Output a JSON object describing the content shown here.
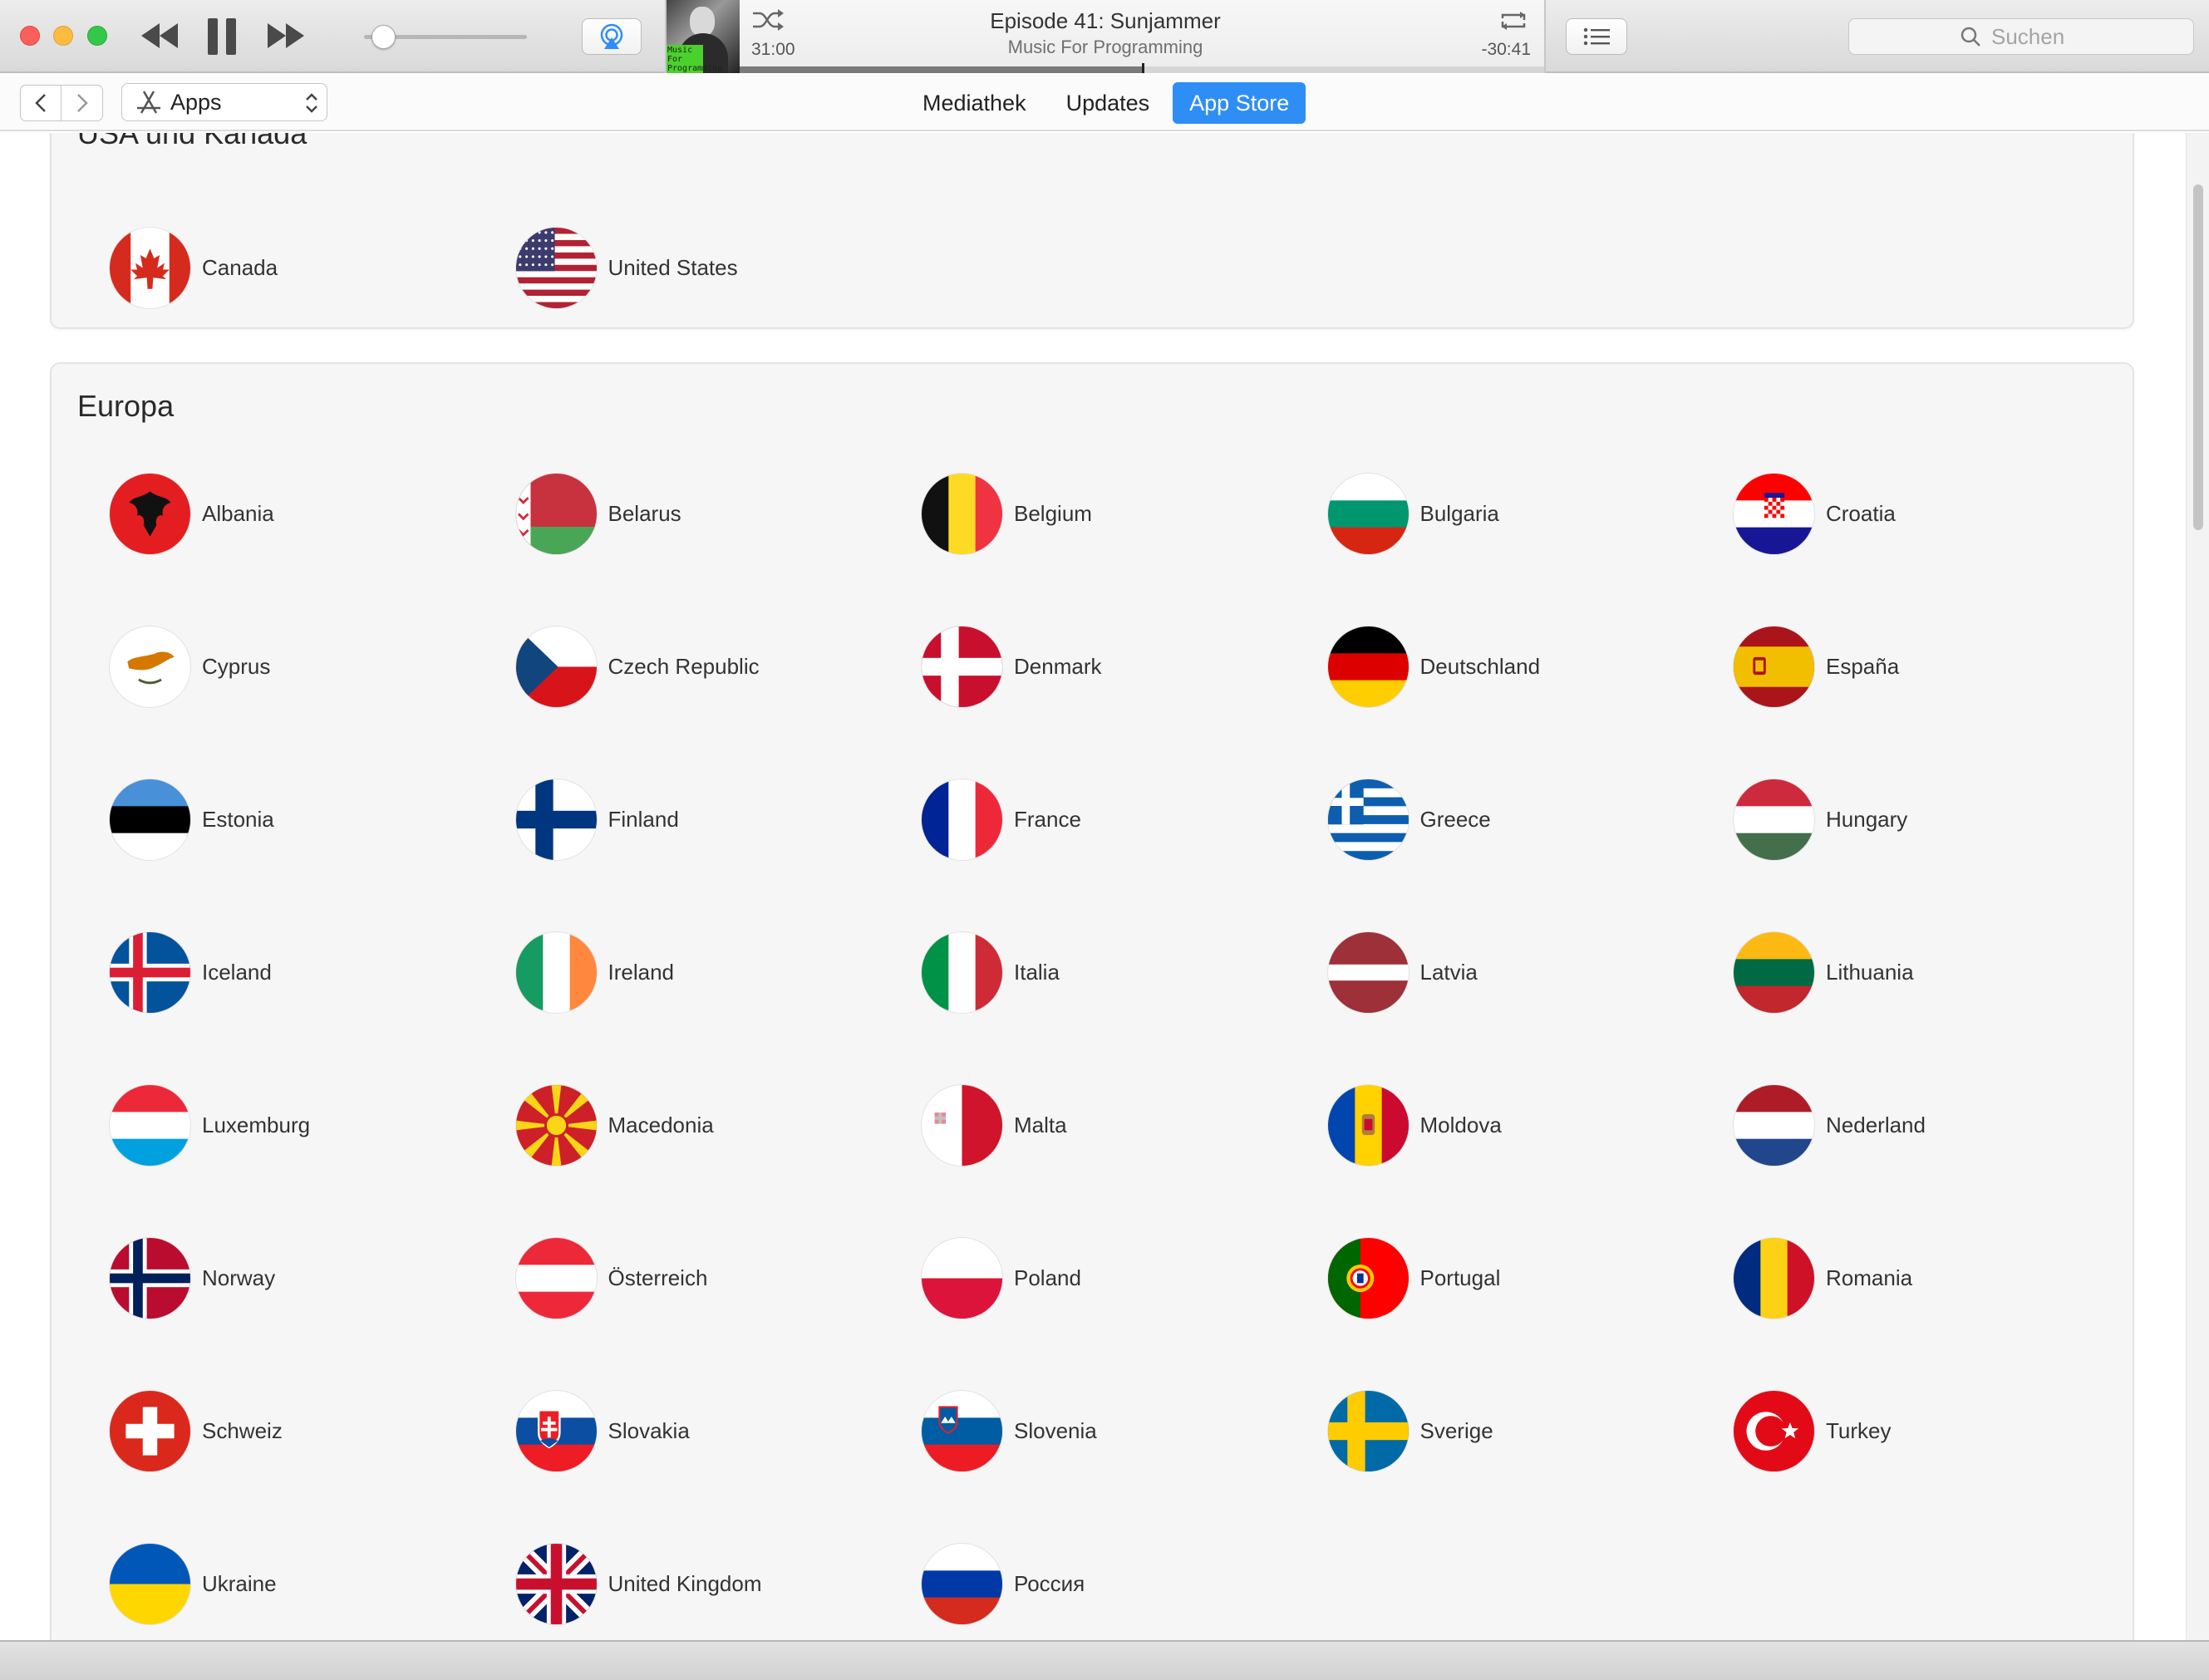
{
  "player": {
    "title": "Episode 41: Sunjammer",
    "artist": "Music For Programming",
    "elapsed": "31:00",
    "remaining": "-30:41",
    "progress": 0.5,
    "volume": 0.05,
    "artwork_label": "Music For Programming"
  },
  "search": {
    "placeholder": "Suchen"
  },
  "nav": {
    "media_kind": "Apps",
    "tabs": [
      {
        "label": "Mediathek",
        "active": false
      },
      {
        "label": "Updates",
        "active": false
      },
      {
        "label": "App Store",
        "active": true
      }
    ]
  },
  "sections": [
    {
      "title": "USA und Kanada",
      "countries": [
        {
          "name": "Canada",
          "flag": "ca"
        },
        {
          "name": "United States",
          "flag": "us"
        }
      ]
    },
    {
      "title": "Europa",
      "countries": [
        {
          "name": "Albania",
          "flag": "al"
        },
        {
          "name": "Belarus",
          "flag": "by"
        },
        {
          "name": "Belgium",
          "flag": "be"
        },
        {
          "name": "Bulgaria",
          "flag": "bg"
        },
        {
          "name": "Croatia",
          "flag": "hr"
        },
        {
          "name": "Cyprus",
          "flag": "cy"
        },
        {
          "name": "Czech Republic",
          "flag": "cz"
        },
        {
          "name": "Denmark",
          "flag": "dk"
        },
        {
          "name": "Deutschland",
          "flag": "de"
        },
        {
          "name": "España",
          "flag": "es"
        },
        {
          "name": "Estonia",
          "flag": "ee"
        },
        {
          "name": "Finland",
          "flag": "fi"
        },
        {
          "name": "France",
          "flag": "fr"
        },
        {
          "name": "Greece",
          "flag": "gr"
        },
        {
          "name": "Hungary",
          "flag": "hu"
        },
        {
          "name": "Iceland",
          "flag": "is"
        },
        {
          "name": "Ireland",
          "flag": "ie"
        },
        {
          "name": "Italia",
          "flag": "it"
        },
        {
          "name": "Latvia",
          "flag": "lv"
        },
        {
          "name": "Lithuania",
          "flag": "lt"
        },
        {
          "name": "Luxemburg",
          "flag": "lu"
        },
        {
          "name": "Macedonia",
          "flag": "mk"
        },
        {
          "name": "Malta",
          "flag": "mt"
        },
        {
          "name": "Moldova",
          "flag": "md"
        },
        {
          "name": "Nederland",
          "flag": "nl"
        },
        {
          "name": "Norway",
          "flag": "no"
        },
        {
          "name": "Österreich",
          "flag": "at"
        },
        {
          "name": "Poland",
          "flag": "pl"
        },
        {
          "name": "Portugal",
          "flag": "pt"
        },
        {
          "name": "Romania",
          "flag": "ro"
        },
        {
          "name": "Schweiz",
          "flag": "ch"
        },
        {
          "name": "Slovakia",
          "flag": "sk"
        },
        {
          "name": "Slovenia",
          "flag": "si"
        },
        {
          "name": "Sverige",
          "flag": "se"
        },
        {
          "name": "Turkey",
          "flag": "tr"
        },
        {
          "name": "Ukraine",
          "flag": "ua"
        },
        {
          "name": "United Kingdom",
          "flag": "gb"
        },
        {
          "name": "Россия",
          "flag": "ru"
        }
      ]
    }
  ]
}
